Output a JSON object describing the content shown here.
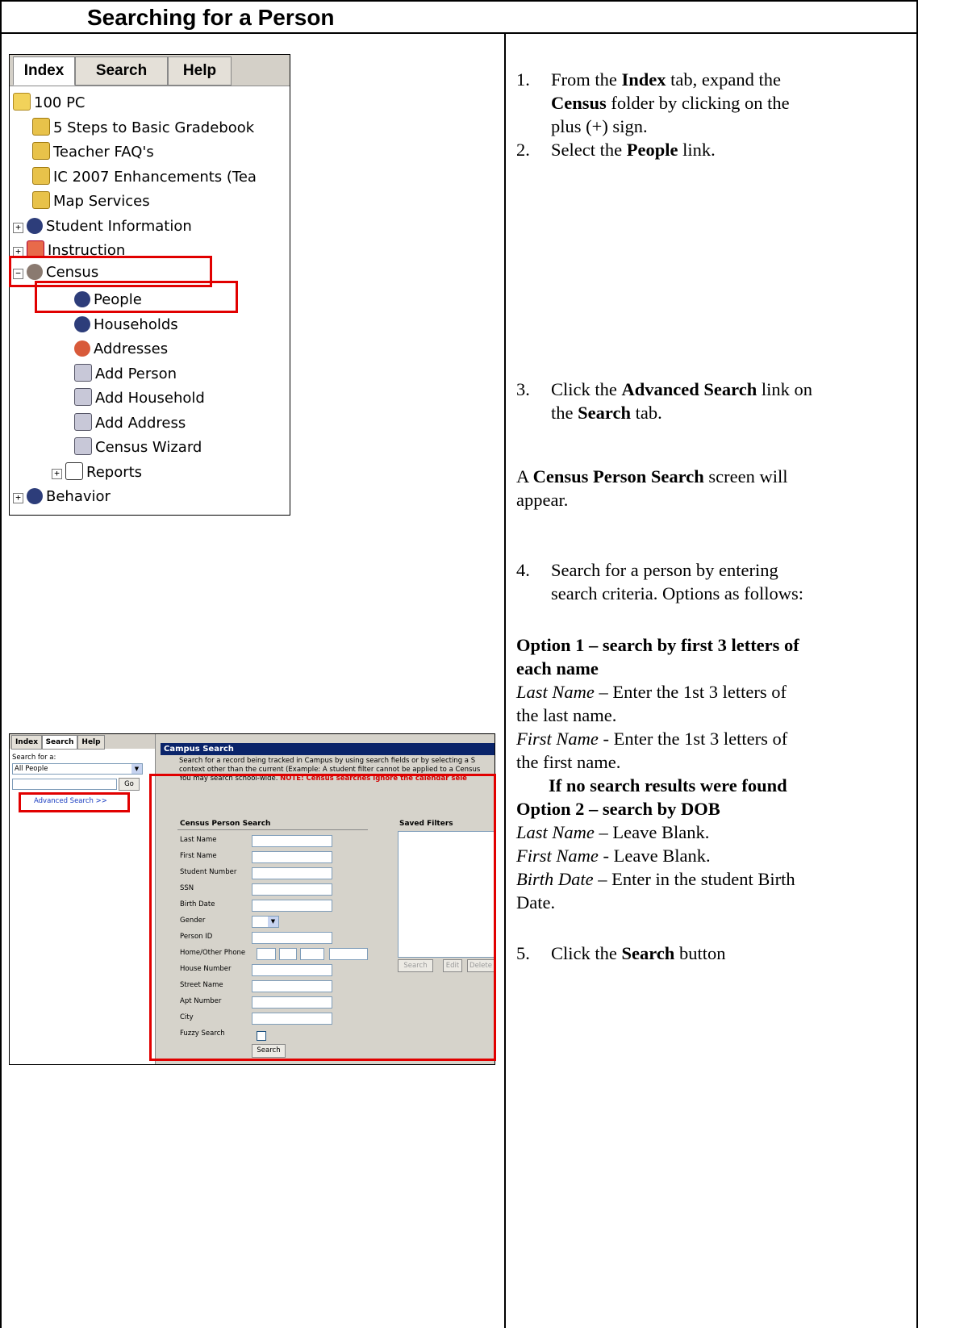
{
  "page": {
    "title": "Searching for a Person"
  },
  "tree_shot": {
    "tabs": [
      "Index",
      "Search",
      "Help"
    ],
    "nodes": [
      {
        "label": "100 PC"
      },
      {
        "label": "5 Steps to Basic Gradebook"
      },
      {
        "label": "Teacher FAQ's"
      },
      {
        "label": "IC 2007 Enhancements (Tea"
      },
      {
        "label": "Map Services"
      },
      {
        "label": "Student Information",
        "toggle": "+"
      },
      {
        "label": "Instruction",
        "toggle": "+"
      },
      {
        "label": "Census",
        "toggle": "−"
      },
      {
        "label": "People"
      },
      {
        "label": "Households"
      },
      {
        "label": "Addresses"
      },
      {
        "label": "Add Person"
      },
      {
        "label": "Add Household"
      },
      {
        "label": "Add Address"
      },
      {
        "label": "Census Wizard"
      },
      {
        "label": "Reports",
        "toggle": "+"
      },
      {
        "label": "Behavior",
        "toggle": "+"
      }
    ],
    "highlight_color": "#e10000"
  },
  "search_shot": {
    "tabs": [
      "Index",
      "Search",
      "Help"
    ],
    "search_for_label": "Search for a:",
    "search_for_value": "All People",
    "go_label": "Go",
    "advanced_link": "Advanced Search >>",
    "window_title": "Campus Search",
    "desc_line1": "Search for a record being tracked in Campus by using search fields or by selecting a S",
    "desc_line2": "context other than the current (Example: A student filter cannot be applied to a Census",
    "desc_line3_plain": "You may search school-wide. ",
    "desc_line3_note": "NOTE: Census searches ignore the calendar sele",
    "form_title": "Census Person Search",
    "saved_filters_title": "Saved Filters",
    "fields": [
      "Last Name",
      "First Name",
      "Student Number",
      "SSN",
      "Birth Date",
      "Gender",
      "Person ID",
      "Home/Other Phone",
      "House Number",
      "Street Name",
      "Apt Number",
      "City",
      "Fuzzy Search"
    ],
    "search_button": "Search",
    "filter_buttons": [
      "Search",
      "Edit",
      "Delete"
    ]
  },
  "instructions": {
    "s1_num": "1.",
    "s1_a": "From the ",
    "s1_b": "Index",
    "s1_c": " tab, expand the",
    "s1_d": "Census",
    "s1_e": " folder by clicking on the",
    "s1_f": "plus (+) sign.",
    "s2_num": "2.",
    "s2_a": "Select the ",
    "s2_b": "People",
    "s2_c": " link.",
    "s3_num": "3.",
    "s3_a": "Click the ",
    "s3_b": "Advanced Search",
    "s3_c": " link on",
    "s3_d": "the ",
    "s3_e": "Search",
    "s3_f": " tab.",
    "p1_a": "A ",
    "p1_b": "Census Person Search",
    "p1_c": " screen will",
    "p1_d": "appear.",
    "s4_num": "4.",
    "s4_a": "Search for a person by entering",
    "s4_b": "search criteria.  Options as follows:",
    "opt1_title_a": "Option 1 – search by first 3 letters of",
    "opt1_title_b": "each name",
    "opt1_ln_label": "Last Name",
    "opt1_ln_text": " – Enter the 1st 3 letters of",
    "opt1_ln_text2": "the last name.",
    "opt1_fn_label": "First Name",
    "opt1_fn_text": " - Enter the 1st 3 letters of",
    "opt1_fn_text2": "the first name.",
    "no_results": "If no search results were found",
    "opt2_title": "Option 2 – search by DOB",
    "opt2_ln_label": "Last Name",
    "opt2_ln_text": " – Leave Blank.",
    "opt2_fn_label": "First Name",
    "opt2_fn_text": " - Leave Blank.",
    "opt2_bd_label": "Birth Date",
    "opt2_bd_text": " – Enter in the student Birth",
    "opt2_bd_text2": "Date.",
    "s5_num": "5.",
    "s5_a": "Click the ",
    "s5_b": "Search",
    "s5_c": " button"
  }
}
